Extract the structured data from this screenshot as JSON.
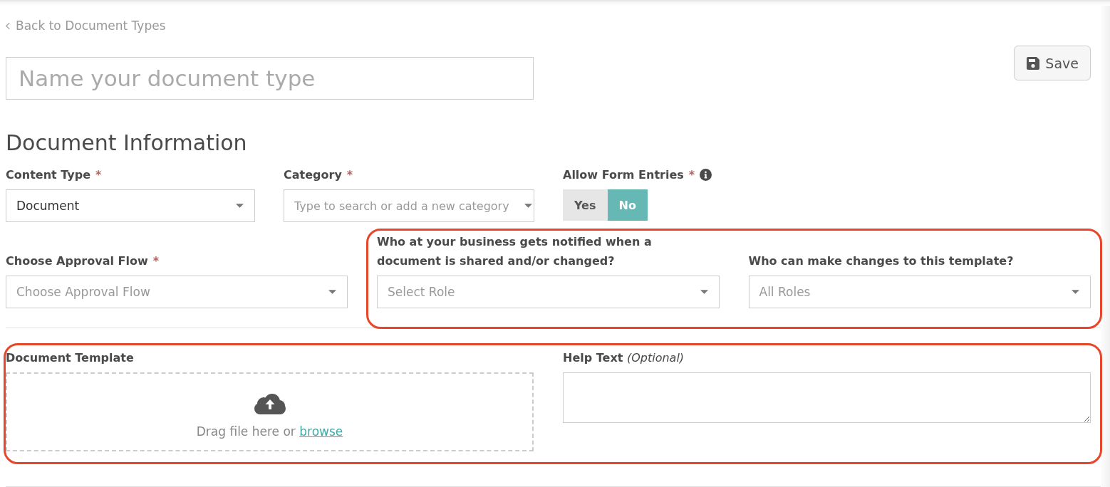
{
  "back_link": {
    "label": "Back to Document Types"
  },
  "name_field": {
    "placeholder": "Name your document type"
  },
  "save_button": {
    "label": "Save"
  },
  "section": {
    "title": "Document Information"
  },
  "rows": [
    {
      "cells": [
        {
          "kind": "select",
          "label": "Content Type",
          "required_mark": "*",
          "value": "Document"
        },
        {
          "kind": "combobox",
          "label": "Category",
          "required_mark": "*",
          "placeholder": "Type to search or add a new category"
        },
        {
          "kind": "toggle",
          "label": "Allow Form Entries",
          "required_mark": "*",
          "info": true,
          "options": [
            {
              "label": "Yes",
              "selected": false
            },
            {
              "label": "No",
              "selected": true
            }
          ]
        }
      ]
    },
    {
      "cells": [
        {
          "kind": "select",
          "label": "Choose Approval Flow",
          "required_mark": "*",
          "placeholder": "Choose Approval Flow"
        },
        {
          "kind": "group",
          "highlighted": true,
          "cells": [
            {
              "kind": "select",
              "label": "Who at your business gets notified when a document is shared and/or changed?",
              "placeholder": "Select Role"
            },
            {
              "kind": "select",
              "label": "Who can make changes to this template?",
              "placeholder": "All Roles"
            }
          ]
        }
      ]
    },
    {
      "cells": [
        {
          "kind": "group",
          "highlighted": true,
          "cells": [
            {
              "kind": "upload",
              "label": "Document Template",
              "prompt": "Drag file here or",
              "link": "browse"
            },
            {
              "kind": "textarea",
              "label": "Help Text *(Optional)*"
            }
          ]
        }
      ]
    }
  ]
}
